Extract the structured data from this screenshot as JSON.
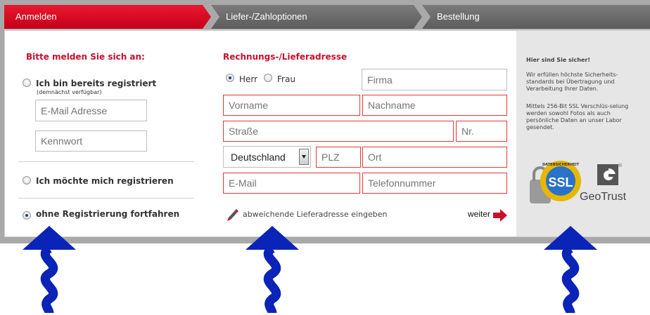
{
  "steps": [
    {
      "label": "Anmelden"
    },
    {
      "label": "Liefer-/Zahloptionen"
    },
    {
      "label": "Bestellung"
    }
  ],
  "login": {
    "heading": "Bitte melden Sie sich an:",
    "option_registered": "Ich bin bereits registriert",
    "option_registered_note": "(demnächst verfügbar)",
    "email_placeholder": "E-Mail Adresse",
    "password_placeholder": "Kennwort",
    "option_register": "Ich möchte mich registrieren",
    "option_guest": "ohne Registrierung fortfahren",
    "selected": "guest"
  },
  "address": {
    "heading": "Rechnungs-/Lieferadresse",
    "salutation_herr": "Herr",
    "salutation_frau": "Frau",
    "salutation_selected": "Herr",
    "firma_placeholder": "Firma",
    "vorname_placeholder": "Vorname",
    "nachname_placeholder": "Nachname",
    "strasse_placeholder": "Straße",
    "nr_placeholder": "Nr.",
    "country_value": "Deutschland",
    "plz_placeholder": "PLZ",
    "ort_placeholder": "Ort",
    "email_placeholder": "E-Mail",
    "telefon_placeholder": "Telefonnummer",
    "alt_address_link": "abweichende Lieferadresse eingeben",
    "next_label": "weiter"
  },
  "security": {
    "heading": "Hier sind Sie sicher!",
    "text1": "Wir erfüllen höchste Sicherheits-standards bei Übertragung und Verarbeitung Ihrer Daten.",
    "text2": "Mittels 256-Bit SSL Verschlüs-selung werden sowohl Fotos als auch persönliche Daten an unser Labor gesendet.",
    "ssl_badge": "SSL",
    "ssl_ring_text": "DATENSICHERHEIT",
    "geotrust_label": "GeoTrust",
    "geotrust_mark": "®"
  },
  "colors": {
    "active_step": "#d0021b",
    "inactive_step": "#6e6e6e",
    "required_border": "#e03a3a",
    "heading_red": "#c8102e",
    "arrow_blue": "#0a24b8"
  },
  "icons": {
    "alt_address": "pencil-icon",
    "next": "red-arrow-icon",
    "annotation": "wavy-up-arrow-icon"
  }
}
